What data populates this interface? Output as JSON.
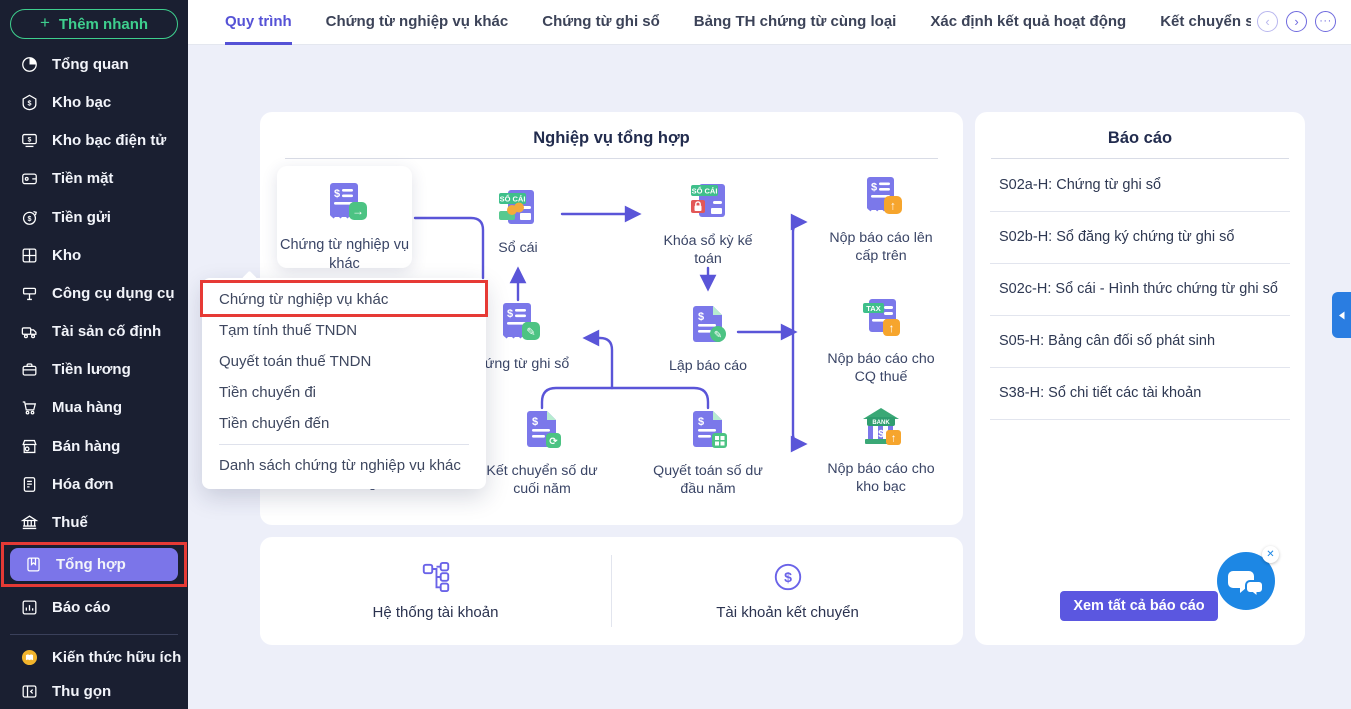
{
  "sidebar": {
    "quick_add": "Thêm nhanh",
    "items": [
      {
        "label": "Tổng quan",
        "icon": "overview-icon"
      },
      {
        "label": "Kho bạc",
        "icon": "treasury-icon"
      },
      {
        "label": "Kho bạc điện tử",
        "icon": "e-treasury-icon"
      },
      {
        "label": "Tiền mặt",
        "icon": "cash-icon"
      },
      {
        "label": "Tiền gửi",
        "icon": "deposit-icon"
      },
      {
        "label": "Kho",
        "icon": "warehouse-icon"
      },
      {
        "label": "Công cụ dụng cụ",
        "icon": "tools-icon"
      },
      {
        "label": "Tài sản cố định",
        "icon": "fixed-asset-icon"
      },
      {
        "label": "Tiền lương",
        "icon": "salary-icon"
      },
      {
        "label": "Mua hàng",
        "icon": "purchase-icon"
      },
      {
        "label": "Bán hàng",
        "icon": "sales-icon"
      },
      {
        "label": "Hóa đơn",
        "icon": "invoice-icon"
      },
      {
        "label": "Thuế",
        "icon": "tax-icon"
      },
      {
        "label": "Tổng hợp",
        "icon": "general-ledger-icon",
        "active": true,
        "annotated": true
      },
      {
        "label": "Báo cáo",
        "icon": "report-icon"
      },
      {
        "label": "Kiến thức hữu ích",
        "icon": "knowledge-icon"
      },
      {
        "label": "Thu gọn",
        "icon": "collapse-icon"
      }
    ]
  },
  "topbar": {
    "tabs": [
      {
        "label": "Quy trình",
        "active": true
      },
      {
        "label": "Chứng từ nghiệp vụ khác"
      },
      {
        "label": "Chứng từ ghi sổ"
      },
      {
        "label": "Bảng TH chứng từ cùng loại"
      },
      {
        "label": "Xác định kết quả hoạt động"
      },
      {
        "label": "Kết chuyển s"
      }
    ],
    "nav": {
      "prev": "‹",
      "next": "›",
      "more": "···"
    }
  },
  "workflow": {
    "title": "Nghiệp vụ tổng hợp",
    "nodes": {
      "cta": {
        "label": "Chứng từ nghiệp vụ khác"
      },
      "so_cai": {
        "label": "Sổ cái"
      },
      "khoa_so": {
        "label": "Khóa sổ kỳ kế toán"
      },
      "nop_cap_tren": {
        "label": "Nộp báo cáo lên cấp trên"
      },
      "ctgs": {
        "label": "Chứng từ ghi sổ"
      },
      "lap_bao_cao": {
        "label": "Lập báo cáo"
      },
      "nop_cq_thue": {
        "label": "Nộp báo cáo cho CQ thuế"
      },
      "ket_chuyen": {
        "label": "Kết chuyển số dư cuối năm"
      },
      "quyet_toan": {
        "label": "Quyết toán số dư đầu năm"
      },
      "nop_kho_bac": {
        "label": "Nộp báo cáo cho kho bạc"
      },
      "partial_hidden": {
        "label": "hoạt động"
      }
    },
    "icon_texts": {
      "so_cai_tag": "SỔ CÁI",
      "tax_tag": "TAX",
      "bank_tag": "BANK"
    },
    "dropdown": {
      "items": [
        "Chứng từ nghiệp vụ khác",
        "Tạm tính thuế TNDN",
        "Quyết toán thuế TNDN",
        "Tiền chuyển đi",
        "Tiền chuyển đến",
        "Danh sách chứng từ nghiệp vụ khác"
      ],
      "highlighted_index": 0
    }
  },
  "reports": {
    "title": "Báo cáo",
    "items": [
      "S02a-H: Chứng từ ghi sổ",
      "S02b-H: Sổ đăng ký chứng từ ghi sổ",
      "S02c-H: Sổ cái - Hình thức chứng từ ghi sổ",
      "S05-H: Bảng cân đối số phát sinh",
      "S38-H: Sổ chi tiết các tài khoản"
    ],
    "view_all": "Xem tất cả báo cáo"
  },
  "bottom_panel": {
    "items": [
      {
        "label": "Hệ thống tài khoản",
        "icon": "account-tree-icon"
      },
      {
        "label": "Tài khoản kết chuyển",
        "icon": "dollar-circle-icon"
      }
    ]
  },
  "colors": {
    "accent_purple": "#5a55d8",
    "sidebar_bg": "#1a1f31",
    "sidebar_active": "#7b75e9",
    "quick_add_green": "#3ecf8e",
    "annotation_red": "#e63a35",
    "node_purple": "#7b78ea",
    "badge_green": "#4cc383",
    "badge_orange": "#f6a52d",
    "lock_red": "#e25757",
    "chat_blue": "#1d87e4",
    "side_tab_blue": "#2a7de1"
  }
}
